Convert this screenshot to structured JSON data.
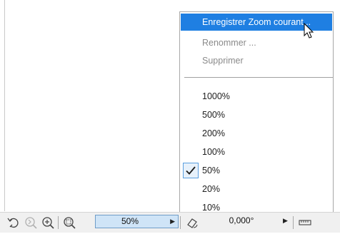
{
  "menu": {
    "items": [
      {
        "label": "Enregistrer Zoom courant...",
        "state": "highlighted"
      },
      {
        "label": "Renommer ...",
        "state": "disabled"
      },
      {
        "label": "Supprimer",
        "state": "disabled"
      }
    ],
    "zoom_levels": [
      {
        "label": "1000%",
        "checked": false
      },
      {
        "label": "500%",
        "checked": false
      },
      {
        "label": "200%",
        "checked": false
      },
      {
        "label": "100%",
        "checked": false
      },
      {
        "label": "50%",
        "checked": true
      },
      {
        "label": "20%",
        "checked": false
      },
      {
        "label": "10%",
        "checked": false
      }
    ]
  },
  "toolbar": {
    "zoom_value": "50%",
    "angle_value": "0,000°",
    "icons": [
      "undo-zoom-icon",
      "redo-zoom-icon",
      "zoom-in-icon",
      "fit-window-icon",
      "rotate-orientation-icon",
      "ruler-icon"
    ]
  },
  "colors": {
    "highlight": "#1f7fe2",
    "disabled_text": "#8a8a8a",
    "zoom_field_bg": "#cfe4f7"
  }
}
